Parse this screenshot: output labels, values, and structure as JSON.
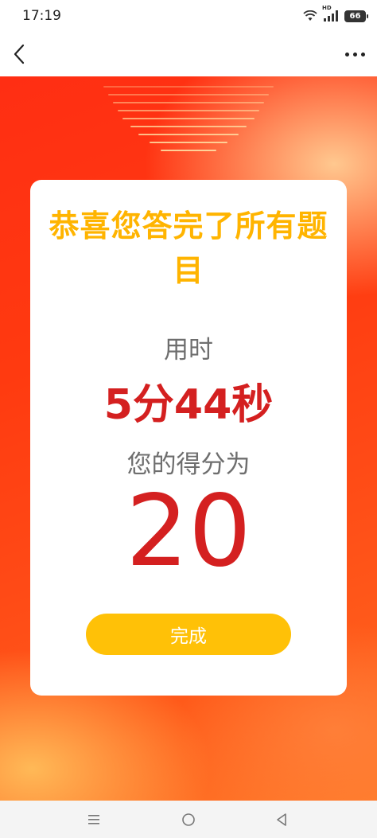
{
  "status_bar": {
    "time": "17:19",
    "network_label": "HD",
    "battery_level": "66"
  },
  "nav": {
    "back_icon": "chevron-left-icon",
    "more_icon": "more-horizontal-icon"
  },
  "result": {
    "title": "恭喜您答完了所有题目",
    "time_label": "用时",
    "time_value": "5分44秒",
    "score_label": "您的得分为",
    "score_value": "20",
    "done_button": "完成"
  },
  "system_nav": {
    "menu_icon": "menu-icon",
    "home_icon": "home-circle-icon",
    "back_icon": "back-triangle-icon"
  },
  "colors": {
    "title": "#ffb400",
    "value": "#d42020",
    "label": "#6e6e6e",
    "button": "#ffc107",
    "background_primary": "#ff2e13"
  }
}
